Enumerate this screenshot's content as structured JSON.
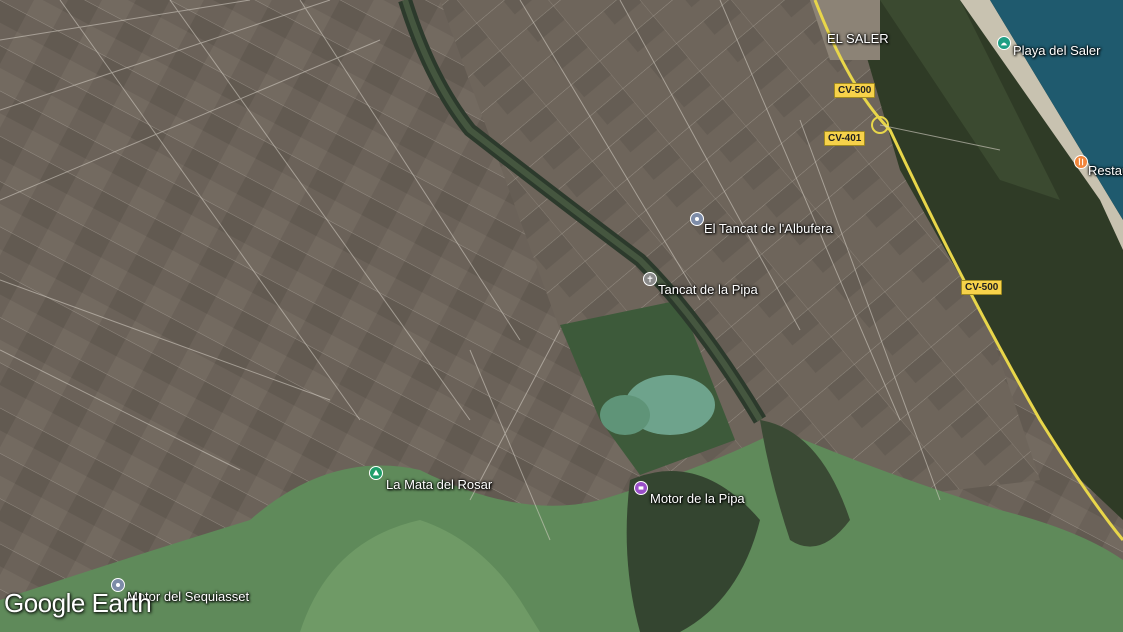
{
  "brand": "Google Earth",
  "places": {
    "el_saler": "EL SALER",
    "playa_saler": "Playa del Saler",
    "restaurant": "Restau",
    "tancat_albufera": "El Tancat de l'Albufera",
    "tancat_pipa": "Tancat de la Pipa",
    "mata_rosar": "La Mata del Rosar",
    "motor_pipa": "Motor de la Pipa",
    "motor_sequiasset": "Motor del Sequiasset"
  },
  "roads": {
    "cv500_top": "CV-500",
    "cv401": "CV-401",
    "cv500_mid": "CV-500"
  },
  "colors": {
    "fields": "#6b6259",
    "water_lagoon": "#5f8a5a",
    "sea": "#1f5a6e",
    "forest": "#2f3b26",
    "road": "#f7d24a"
  },
  "icons": {
    "playa": "beach-icon",
    "restaurant": "restaurant-icon",
    "tancat_albufera": "pin-icon",
    "tancat_pipa": "pin-icon",
    "mata_rosar": "park-icon",
    "motor_pipa": "attraction-icon",
    "motor_sequiasset": "pin-icon"
  }
}
